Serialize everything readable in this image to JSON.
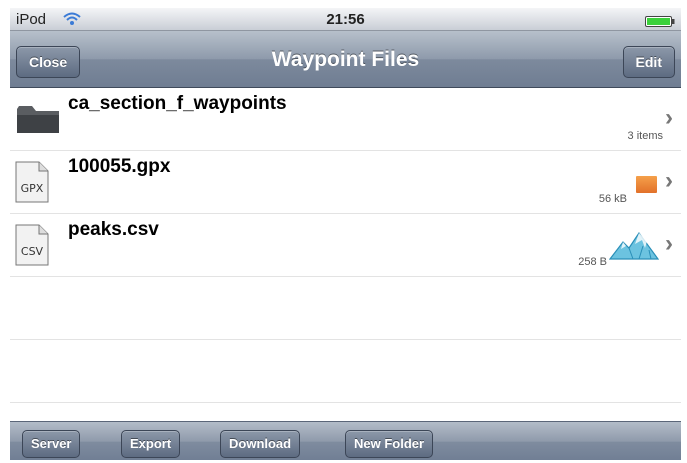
{
  "status_bar": {
    "carrier": "iPod",
    "time": "21:56"
  },
  "nav_bar": {
    "title": "Waypoint Files",
    "left_button": "Close",
    "right_button": "Edit"
  },
  "files": [
    {
      "name": "ca_section_f_waypoints",
      "detail": "3 items",
      "icon": "folder-icon",
      "badge": ""
    },
    {
      "name": "100055.gpx",
      "detail": "56 kB",
      "icon": "gpx-file-icon",
      "icon_label": "GPX",
      "badge": "orange-square-icon"
    },
    {
      "name": "peaks.csv",
      "detail": "258 B",
      "icon": "csv-file-icon",
      "icon_label": "CSV",
      "badge": "mountain-icon"
    }
  ],
  "toolbar": {
    "buttons": [
      "Server",
      "Export",
      "Download",
      "New Folder"
    ]
  },
  "colors": {
    "battery": "#3bd13b",
    "badge_orange": "#e97a2e",
    "mountain": "#3aa6cf"
  }
}
